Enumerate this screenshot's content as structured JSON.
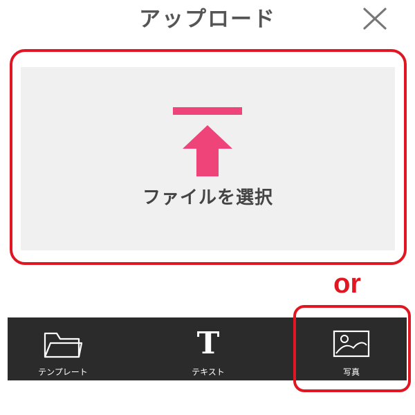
{
  "header": {
    "title": "アップロード",
    "close_icon": "close-icon"
  },
  "upload": {
    "label": "ファイルを選択",
    "icon": "upload-arrow-icon",
    "accent_color": "#ee4479"
  },
  "annotation": {
    "or_text": "or",
    "highlight_color": "#e01622"
  },
  "toolbar": {
    "background": "#2b2b2b",
    "items": [
      {
        "label": "テンプレート",
        "icon": "folder-icon"
      },
      {
        "label": "テキスト",
        "icon": "text-icon",
        "glyph": "T"
      },
      {
        "label": "写真",
        "icon": "photo-icon"
      }
    ]
  }
}
